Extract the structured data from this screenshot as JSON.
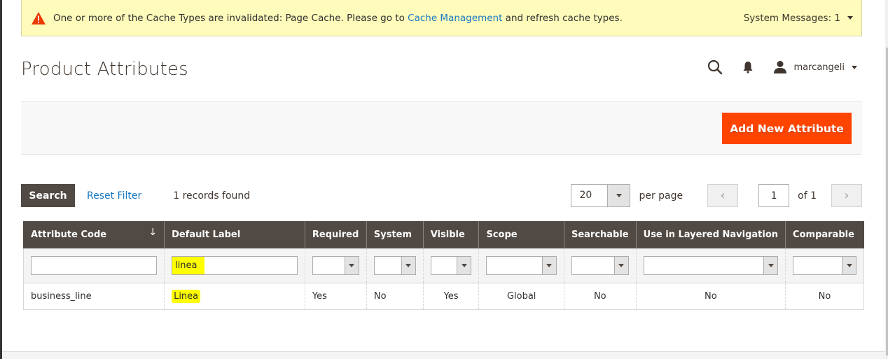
{
  "system_message": {
    "text_before": "One or more of the Cache Types are invalidated: Page Cache. Please go to ",
    "link": "Cache Management",
    "text_after": " and refresh cache types.",
    "count_label": "System Messages: 1",
    "icon": "warning-icon"
  },
  "header": {
    "title": "Product Attributes",
    "search_icon": "search-icon",
    "notifications_icon": "bell-icon",
    "username": "marcangeli"
  },
  "toolbar": {
    "add_button": "Add New Attribute"
  },
  "grid_actions": {
    "search_button": "Search",
    "reset_filter": "Reset Filter",
    "records_found": "1 records found",
    "per_page_value": "20",
    "per_page_label": "per page",
    "prev": "‹",
    "next": "›",
    "current_page": "1",
    "of_pages": "of 1"
  },
  "colors": {
    "accent": "#eb5202",
    "header_bg": "#514943",
    "link": "#1979c3",
    "notice_bg": "#fffbbb",
    "highlight": "#ffff00"
  },
  "grid": {
    "columns": [
      {
        "label": "Attribute Code",
        "sort": "↓"
      },
      {
        "label": "Default Label"
      },
      {
        "label": "Required"
      },
      {
        "label": "System"
      },
      {
        "label": "Visible"
      },
      {
        "label": "Scope"
      },
      {
        "label": "Searchable"
      },
      {
        "label": "Use in Layered Navigation"
      },
      {
        "label": "Comparable"
      }
    ],
    "filters": {
      "attribute_code": "",
      "default_label": "linea",
      "required": "",
      "system": "",
      "visible": "",
      "scope": "",
      "searchable": "",
      "layered_navigation": "",
      "comparable": ""
    },
    "rows": [
      {
        "attribute_code": "business_line",
        "default_label": "Linea",
        "required": "Yes",
        "system": "No",
        "visible": "Yes",
        "scope": "Global",
        "searchable": "No",
        "layered_navigation": "No",
        "comparable": "No"
      }
    ]
  }
}
